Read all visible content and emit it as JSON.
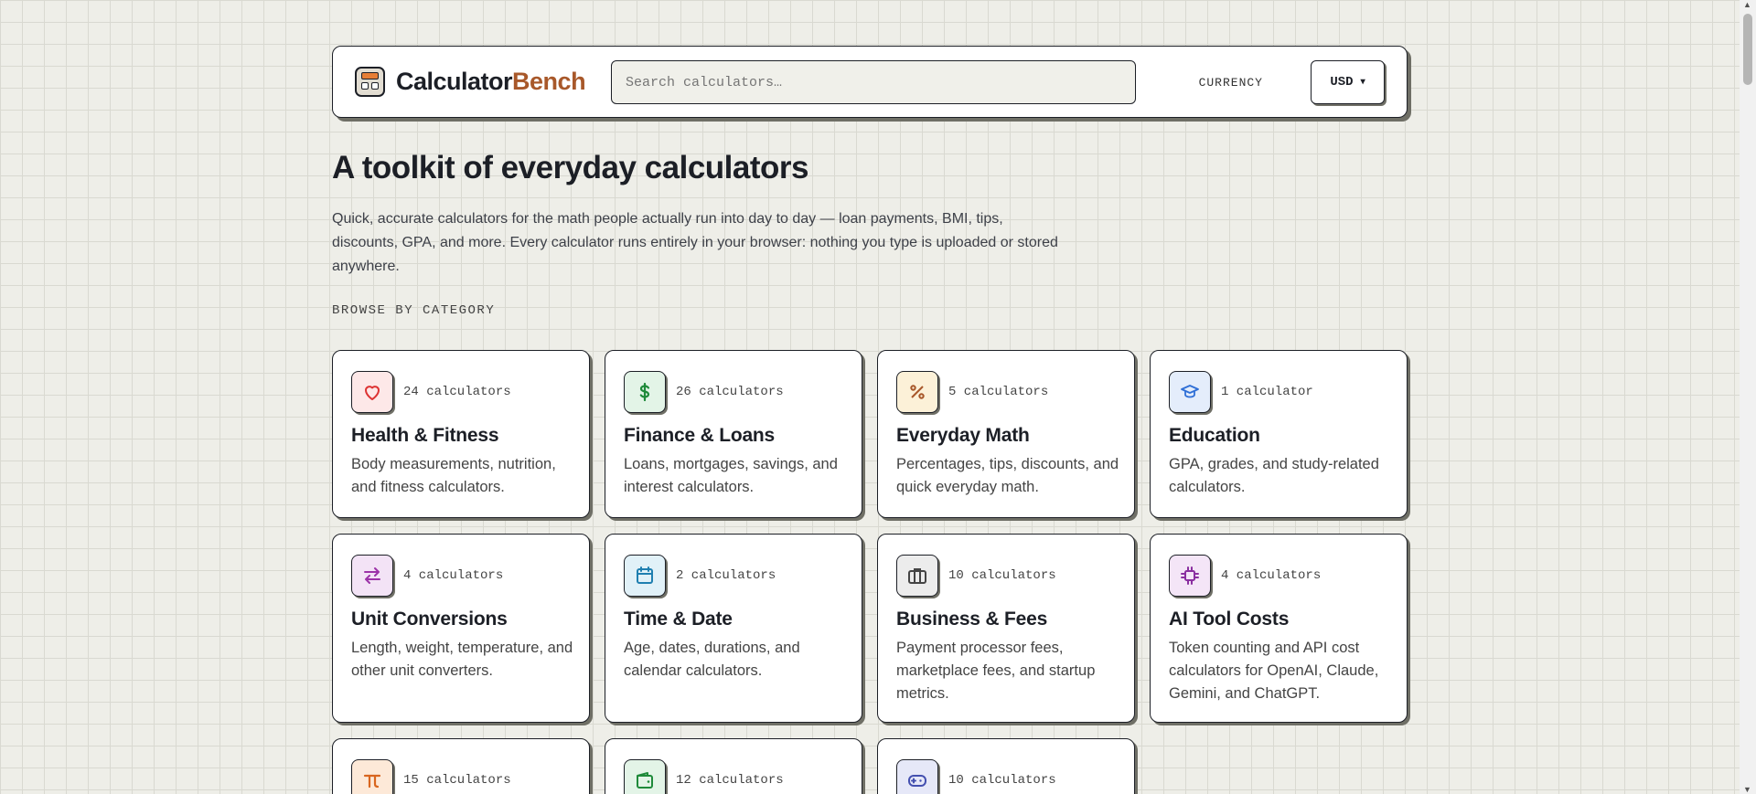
{
  "header": {
    "brand_part1": "Calculator",
    "brand_part2": "Bench",
    "search_placeholder": "Search calculators…",
    "currency_label": "CURRENCY",
    "currency_value": "USD"
  },
  "hero": {
    "title": "A toolkit of everyday calculators",
    "intro": "Quick, accurate calculators for the math people actually run into day to day — loan payments, BMI, tips, discounts, GPA, and more. Every calculator runs entirely in your browser: nothing you type is uploaded or stored anywhere.",
    "browse_label": "BROWSE BY CATEGORY"
  },
  "colors": {
    "accent": "#a8582a",
    "background": "#eeeee8",
    "border": "#1c1f26"
  },
  "categories": [
    {
      "count": "24 calculators",
      "title": "Health & Fitness",
      "desc": "Body measurements, nutrition, and fitness calculators.",
      "icon": "heart-icon",
      "bg": "#fde8e8",
      "fg": "#d33"
    },
    {
      "count": "26 calculators",
      "title": "Finance & Loans",
      "desc": "Loans, mortgages, savings, and interest calculators.",
      "icon": "dollar-icon",
      "bg": "#e3f4e7",
      "fg": "#1f8a3a"
    },
    {
      "count": "5 calculators",
      "title": "Everyday Math",
      "desc": "Percentages, tips, discounts, and quick everyday math.",
      "icon": "percent-icon",
      "bg": "#fcf1d8",
      "fg": "#a8582a"
    },
    {
      "count": "1 calculator",
      "title": "Education",
      "desc": "GPA, grades, and study-related calculators.",
      "icon": "graduation-cap-icon",
      "bg": "#e4edfb",
      "fg": "#2f6fd6"
    },
    {
      "count": "4 calculators",
      "title": "Unit Conversions",
      "desc": "Length, weight, temperature, and other unit converters.",
      "icon": "swap-arrows-icon",
      "bg": "#f3e3f6",
      "fg": "#9c33a8"
    },
    {
      "count": "2 calculators",
      "title": "Time & Date",
      "desc": "Age, dates, durations, and calendar calculators.",
      "icon": "calendar-icon",
      "bg": "#e1f1f8",
      "fg": "#1f7fb0"
    },
    {
      "count": "10 calculators",
      "title": "Business & Fees",
      "desc": "Payment processor fees, marketplace fees, and startup metrics.",
      "icon": "briefcase-icon",
      "bg": "#ececec",
      "fg": "#444"
    },
    {
      "count": "4 calculators",
      "title": "AI Tool Costs",
      "desc": "Token counting and API cost calculators for OpenAI, Claude, Gemini, and ChatGPT.",
      "icon": "chip-icon",
      "bg": "#f4e5f7",
      "fg": "#8a2fa0"
    },
    {
      "count": "15 calculators",
      "title": "",
      "desc": "",
      "icon": "pi-icon",
      "bg": "#fde9d8",
      "fg": "#d9661f"
    },
    {
      "count": "12 calculators",
      "title": "",
      "desc": "",
      "icon": "wallet-icon",
      "bg": "#e3f4e7",
      "fg": "#1f8a3a"
    },
    {
      "count": "10 calculators",
      "title": "",
      "desc": "",
      "icon": "gamepad-icon",
      "bg": "#e6e8f8",
      "fg": "#4450b0"
    }
  ]
}
